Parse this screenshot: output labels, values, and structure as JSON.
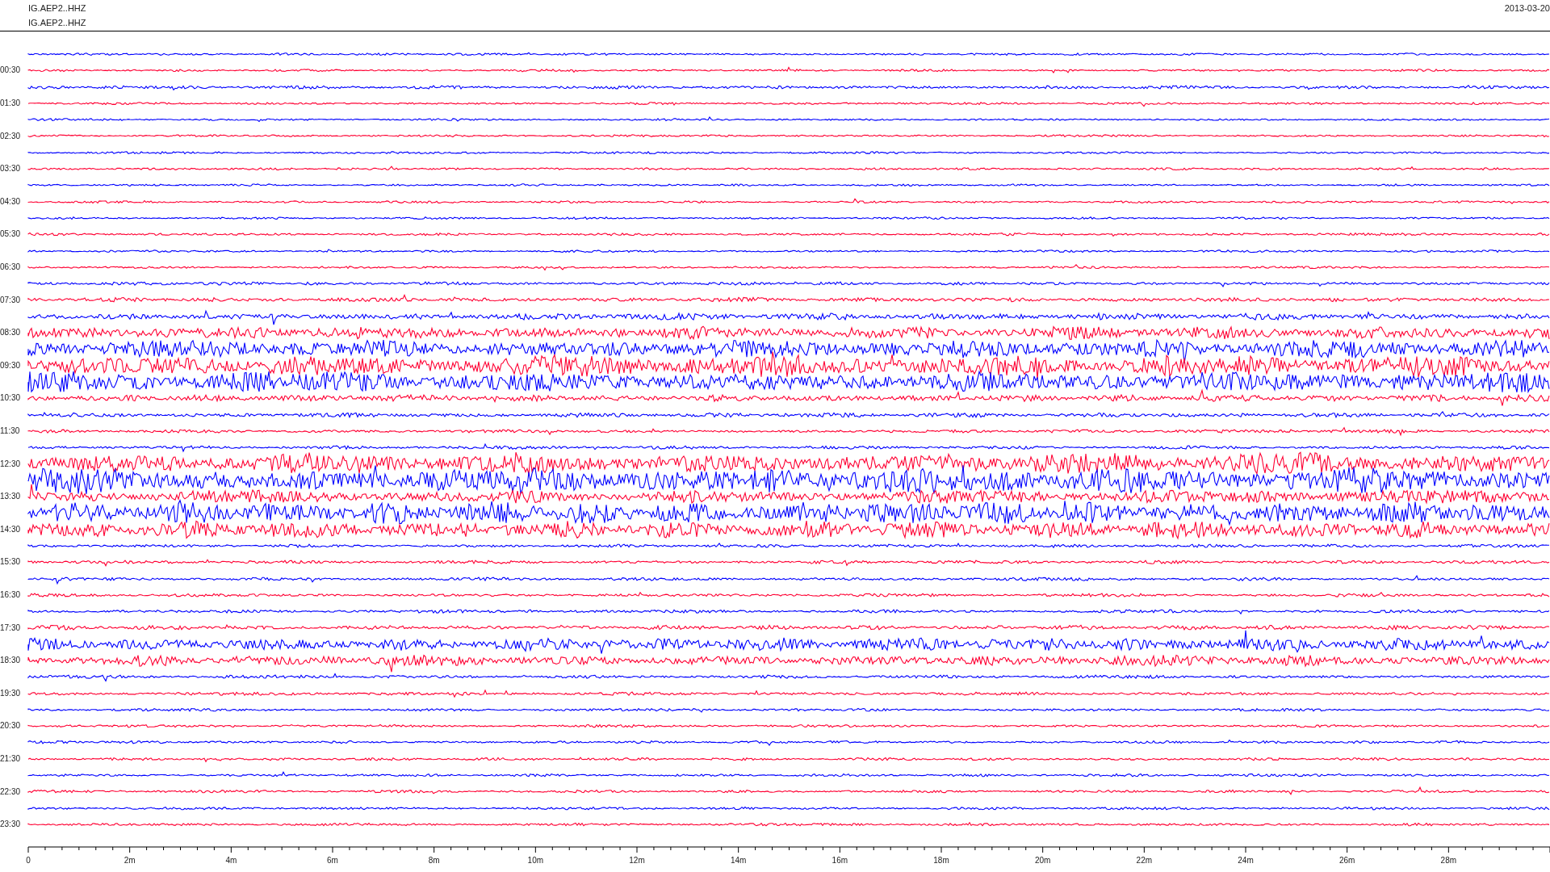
{
  "header": {
    "station_lines": [
      "IG.AEP2..HHZ",
      "IG.AEP2..HHZ"
    ],
    "date": "2013-03-20"
  },
  "traces": [
    {
      "color": "#0000ff"
    },
    {
      "color": "#ff0033",
      "label": "00:30"
    },
    {
      "color": "#0000ff"
    },
    {
      "color": "#ff0033",
      "label": "01:30"
    },
    {
      "color": "#0000ff"
    },
    {
      "color": "#ff0033",
      "label": "02:30"
    },
    {
      "color": "#0000ff"
    },
    {
      "color": "#ff0033",
      "label": "03:30"
    },
    {
      "color": "#0000ff"
    },
    {
      "color": "#ff0033",
      "label": "04:30"
    },
    {
      "color": "#0000ff"
    },
    {
      "color": "#ff0033",
      "label": "05:30"
    },
    {
      "color": "#0000ff"
    },
    {
      "color": "#ff0033",
      "label": "06:30"
    },
    {
      "color": "#0000ff"
    },
    {
      "color": "#ff0033",
      "label": "07:30"
    },
    {
      "color": "#0000ff"
    },
    {
      "color": "#ff0033",
      "label": "08:30"
    },
    {
      "color": "#0000ff"
    },
    {
      "color": "#ff0033",
      "label": "09:30"
    },
    {
      "color": "#0000ff"
    },
    {
      "color": "#ff0033",
      "label": "10:30"
    },
    {
      "color": "#0000ff"
    },
    {
      "color": "#ff0033",
      "label": "11:30"
    },
    {
      "color": "#0000ff"
    },
    {
      "color": "#ff0033",
      "label": "12:30"
    },
    {
      "color": "#0000ff"
    },
    {
      "color": "#ff0033",
      "label": "13:30"
    },
    {
      "color": "#0000ff"
    },
    {
      "color": "#ff0033",
      "label": "14:30"
    },
    {
      "color": "#0000ff"
    },
    {
      "color": "#ff0033",
      "label": "15:30"
    },
    {
      "color": "#0000ff"
    },
    {
      "color": "#ff0033",
      "label": "16:30"
    },
    {
      "color": "#0000ff"
    },
    {
      "color": "#ff0033",
      "label": "17:30"
    },
    {
      "color": "#0000ff"
    },
    {
      "color": "#ff0033",
      "label": "18:30"
    },
    {
      "color": "#0000ff"
    },
    {
      "color": "#ff0033",
      "label": "19:30"
    },
    {
      "color": "#0000ff"
    },
    {
      "color": "#ff0033",
      "label": "20:30"
    },
    {
      "color": "#0000ff"
    },
    {
      "color": "#ff0033",
      "label": "21:30"
    },
    {
      "color": "#0000ff"
    },
    {
      "color": "#ff0033",
      "label": "22:30"
    },
    {
      "color": "#0000ff"
    },
    {
      "color": "#ff0033",
      "label": "23:30"
    }
  ],
  "x_axis": {
    "tick_labels": [
      "0",
      "2m",
      "4m",
      "6m",
      "8m",
      "10m",
      "12m",
      "14m",
      "16m",
      "18m",
      "20m",
      "22m",
      "24m",
      "26m",
      "28m"
    ]
  }
}
